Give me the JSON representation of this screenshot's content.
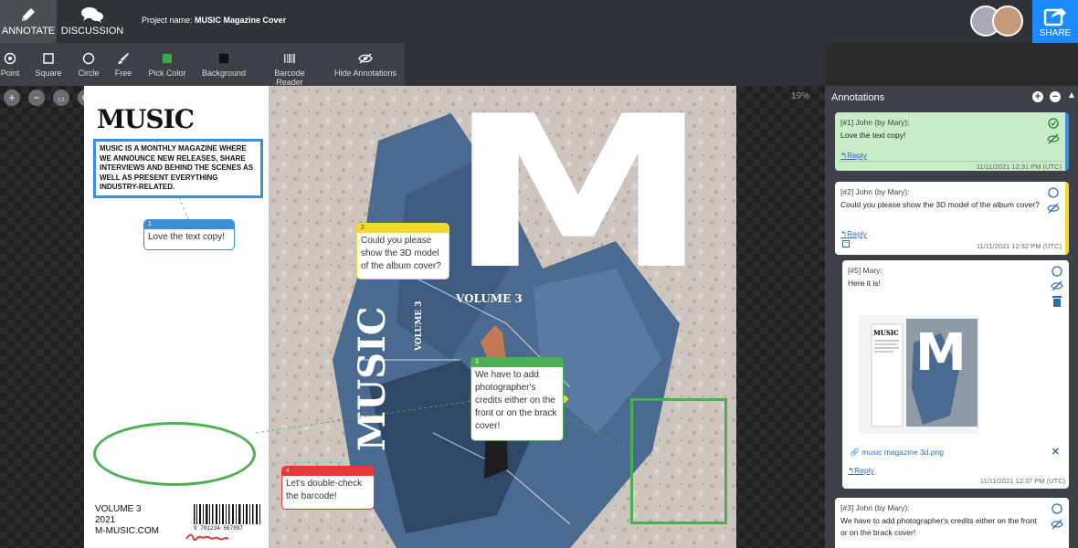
{
  "header": {
    "modes": [
      {
        "label": "ANNOTATE",
        "icon": "pencil-icon"
      },
      {
        "label": "DISCUSSION",
        "icon": "chat-bubbles-icon"
      }
    ],
    "project_label": "Project name:",
    "project_name": "MUSIC Magazine Cover",
    "share_label": "SHARE"
  },
  "toolbar": {
    "tools": [
      {
        "label": "Point",
        "icon": "point-icon"
      },
      {
        "label": "Square",
        "icon": "square-icon"
      },
      {
        "label": "Circle",
        "icon": "circle-icon"
      },
      {
        "label": "Free",
        "icon": "brush-icon"
      },
      {
        "label": "Pick Color",
        "icon": "color-swatch-icon"
      },
      {
        "label": "Background",
        "icon": "background-icon"
      },
      {
        "label": "Barcode Reader",
        "icon": "barcode-icon"
      },
      {
        "label": "Hide Annotations",
        "icon": "eye-off-icon"
      }
    ]
  },
  "canvas": {
    "zoom": "19%",
    "cover": {
      "title": "MUSIC",
      "description": "MUSIC IS A MONTHLY MAGAZINE WHERE WE ANNOUNCE NEW RELEASES, SHARE INTERVIEWS AND BEHIND THE SCENES AS WELL AS PRESENT EVERYTHING INDUSTRY-RELATED.",
      "footer_volume": "VOLUME 3",
      "footer_year": "2021",
      "footer_site": "M-MUSIC.COM",
      "barcode_number": "9 781234 567897",
      "big_letter": "M",
      "volume_label": "VOLUME 3",
      "spine_title": "MUSIC",
      "spine_volume": "VOLUME 3"
    },
    "notes": [
      {
        "num": "1",
        "text": "Love the text copy!",
        "color": "#3a8fd8"
      },
      {
        "num": "2",
        "text": "Could you please show the 3D model of the album cover?",
        "color": "#f4d832"
      },
      {
        "num": "3",
        "text": "We have to add photographer's credits either on the front or on the brack cover!",
        "color": "#4caf50"
      },
      {
        "num": "4",
        "text": "Let's double-check the barcode!",
        "color": "#e53935"
      }
    ]
  },
  "panel": {
    "title": "Annotations",
    "cards": [
      {
        "meta": "[#1] John (by Mary):",
        "text": "Love the text copy!",
        "reply": "Reply",
        "time": "11/11/2021 12:31 PM (UTC)"
      },
      {
        "meta": "[#2] John (by Mary):",
        "text": "Could you please show the 3D model of the album cover?",
        "reply": "Reply",
        "time": "11/11/2021 12:32 PM (UTC)"
      },
      {
        "meta": "[#5] Mary:",
        "text": "Here it is!",
        "file": "music magazine 3d.png",
        "reply": "Reply",
        "time": "11/11/2021 12:37 PM (UTC)",
        "thumb_title": "MUSIC",
        "thumb_letter": "M"
      },
      {
        "meta": "[#3] John (by Mary):",
        "text": "We have to add photographer's credits either on the front or on the brack cover!"
      }
    ]
  }
}
